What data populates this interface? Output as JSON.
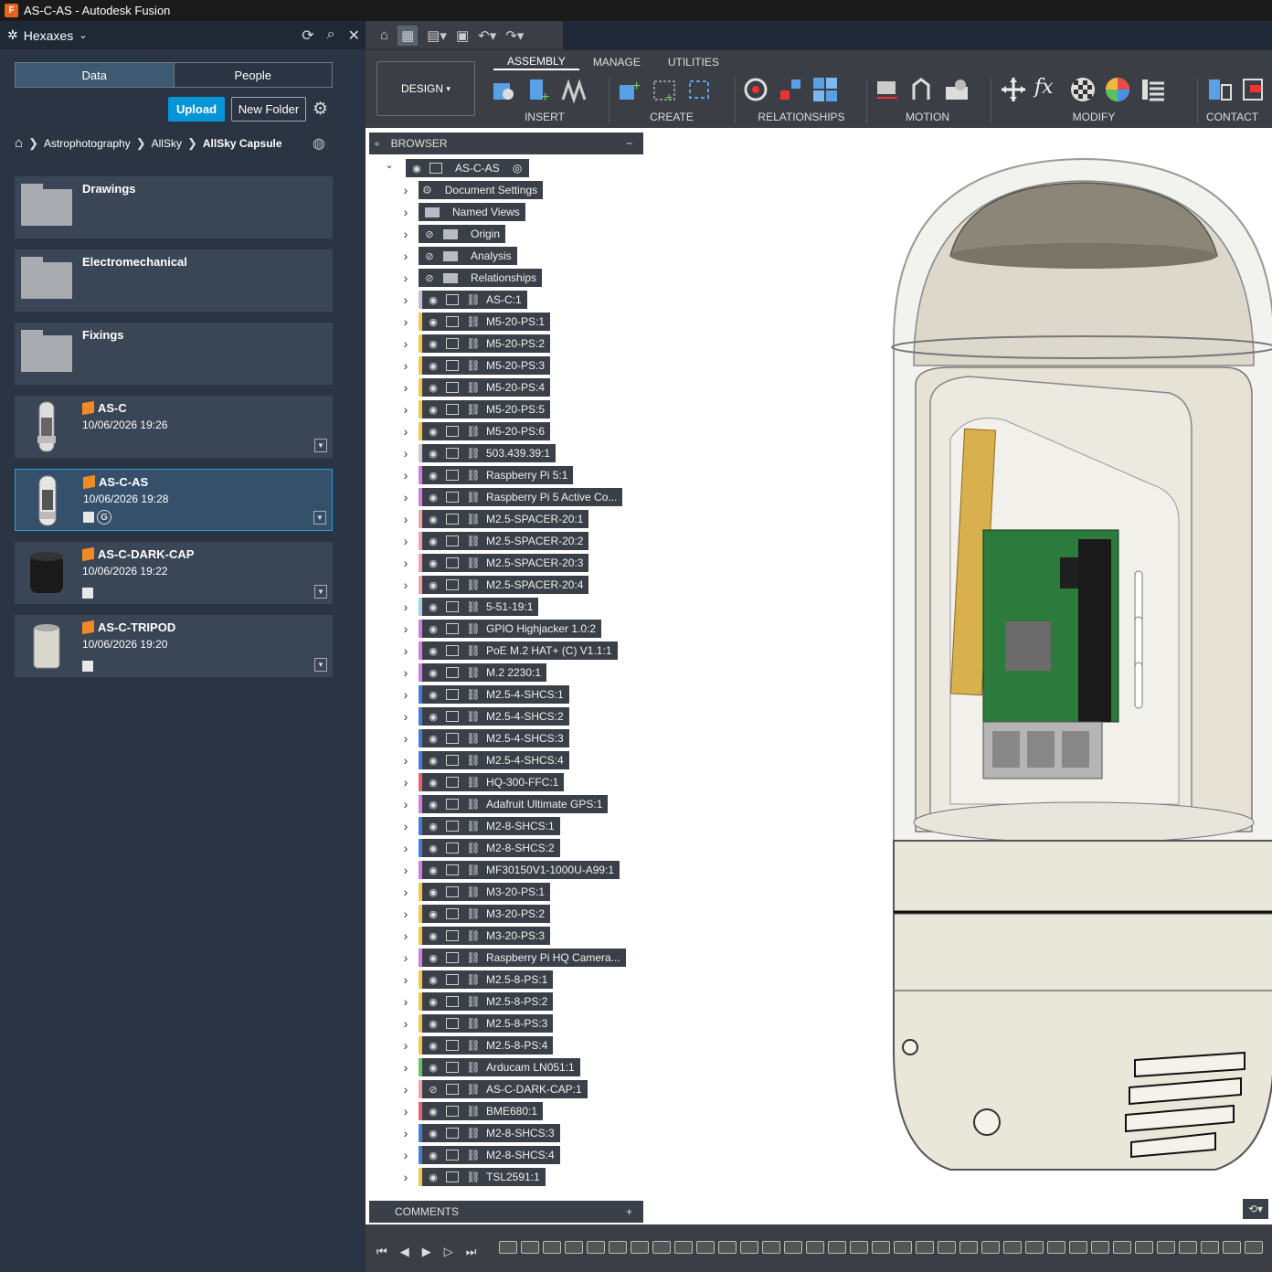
{
  "window": {
    "title": "AS-C-AS - Autodesk Fusion"
  },
  "data_panel": {
    "team": "Hexaxes",
    "tabs": [
      "Data",
      "People"
    ],
    "upload_label": "Upload",
    "new_folder_label": "New Folder",
    "breadcrumb": [
      "Astrophotography",
      "AllSky",
      "AllSky Capsule"
    ],
    "items": [
      {
        "name": "Drawings",
        "kind": "folder"
      },
      {
        "name": "Electromechanical",
        "kind": "folder"
      },
      {
        "name": "Fixings",
        "kind": "folder"
      },
      {
        "name": "AS-C",
        "kind": "design",
        "date": "10/06/2026 19:26"
      },
      {
        "name": "AS-C-AS",
        "kind": "design",
        "date": "10/06/2026 19:28",
        "selected": true
      },
      {
        "name": "AS-C-DARK-CAP",
        "kind": "design",
        "date": "10/06/2026 19:22"
      },
      {
        "name": "AS-C-TRIPOD",
        "kind": "design",
        "date": "10/06/2026 19:20"
      }
    ]
  },
  "toolbar": {
    "workspace": "DESIGN",
    "tabs": [
      "ASSEMBLY",
      "MANAGE",
      "UTILITIES"
    ],
    "active_tab": "ASSEMBLY",
    "groups": [
      "INSERT",
      "CREATE",
      "RELATIONSHIPS",
      "MOTION",
      "MODIFY",
      "CONTACT"
    ]
  },
  "browser": {
    "title": "BROWSER",
    "root": "AS-C-AS",
    "folders": [
      "Document Settings",
      "Named Views",
      "Origin",
      "Analysis",
      "Relationships"
    ],
    "components": [
      {
        "label": "AS-C:1",
        "color": "#c9b8e0"
      },
      {
        "label": "M5-20-PS:1",
        "color": "#f2c84b"
      },
      {
        "label": "M5-20-PS:2",
        "color": "#f2c84b"
      },
      {
        "label": "M5-20-PS:3",
        "color": "#f2c84b"
      },
      {
        "label": "M5-20-PS:4",
        "color": "#f2c84b"
      },
      {
        "label": "M5-20-PS:5",
        "color": "#f2c84b"
      },
      {
        "label": "M5-20-PS:6",
        "color": "#f2c84b"
      },
      {
        "label": "503.439.39:1",
        "color": "#c9c9d6"
      },
      {
        "label": "Raspberry Pi 5:1",
        "color": "#d07de0"
      },
      {
        "label": "Raspberry Pi 5 Active Co...",
        "color": "#d07de0"
      },
      {
        "label": "M2.5-SPACER-20:1",
        "color": "#f0a0a8"
      },
      {
        "label": "M2.5-SPACER-20:2",
        "color": "#f0a0a8"
      },
      {
        "label": "M2.5-SPACER-20:3",
        "color": "#f0a0a8"
      },
      {
        "label": "M2.5-SPACER-20:4",
        "color": "#f0a0a8"
      },
      {
        "label": "5-51-19:1",
        "color": "#9fd0e8"
      },
      {
        "label": "GPIO Highjacker 1.0:2",
        "color": "#d07de0"
      },
      {
        "label": "PoE M.2 HAT+ (C) V1.1:1",
        "color": "#d07de0"
      },
      {
        "label": "M.2 2230:1",
        "color": "#d07de0"
      },
      {
        "label": "M2.5-4-SHCS:1",
        "color": "#4a78d8"
      },
      {
        "label": "M2.5-4-SHCS:2",
        "color": "#4a78d8"
      },
      {
        "label": "M2.5-4-SHCS:3",
        "color": "#4a78d8"
      },
      {
        "label": "M2.5-4-SHCS:4",
        "color": "#4a78d8"
      },
      {
        "label": "HQ-300-FFC:1",
        "color": "#e86070"
      },
      {
        "label": "Adafruit Ultimate GPS:1",
        "color": "#d07de0"
      },
      {
        "label": "M2-8-SHCS:1",
        "color": "#4a78d8"
      },
      {
        "label": "M2-8-SHCS:2",
        "color": "#4a78d8"
      },
      {
        "label": "MF30150V1-1000U-A99:1",
        "color": "#d07de0"
      },
      {
        "label": "M3-20-PS:1",
        "color": "#f2c84b"
      },
      {
        "label": "M3-20-PS:2",
        "color": "#f2c84b"
      },
      {
        "label": "M3-20-PS:3",
        "color": "#f2c84b"
      },
      {
        "label": "Raspberry Pi HQ Camera...",
        "color": "#d07de0"
      },
      {
        "label": "M2.5-8-PS:1",
        "color": "#f2c84b"
      },
      {
        "label": "M2.5-8-PS:2",
        "color": "#f2c84b"
      },
      {
        "label": "M2.5-8-PS:3",
        "color": "#f2c84b"
      },
      {
        "label": "M2.5-8-PS:4",
        "color": "#f2c84b"
      },
      {
        "label": "Arducam LN051:1",
        "color": "#6cc060"
      },
      {
        "label": "AS-C-DARK-CAP:1",
        "color": "#f0a0a8"
      },
      {
        "label": "BME680:1",
        "color": "#e86070"
      },
      {
        "label": "M2-8-SHCS:3",
        "color": "#4a78d8"
      },
      {
        "label": "M2-8-SHCS:4",
        "color": "#4a78d8"
      },
      {
        "label": "TSL2591:1",
        "color": "#f2c84b"
      }
    ]
  },
  "comments": {
    "title": "COMMENTS"
  }
}
